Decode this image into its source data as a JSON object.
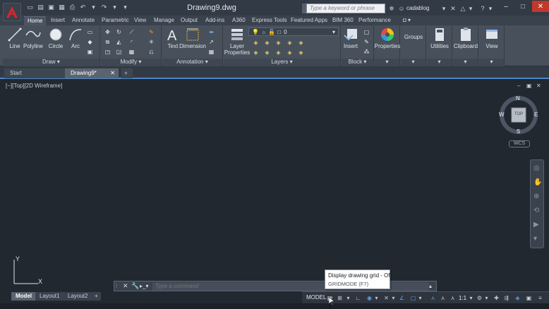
{
  "title_bar": {
    "document_title": "Drawing9.dwg",
    "search_placeholder": "Type a keyword or phrase",
    "user_name": "cadablog",
    "colors": {
      "background": "#323a45",
      "logo_red": "#d0282e",
      "close_button": "#c0392b"
    }
  },
  "quick_access": {
    "icons": [
      "new-icon",
      "open-icon",
      "save-icon",
      "save-as-icon",
      "print-icon",
      "undo-icon",
      "redo-icon",
      "dropdown-icon"
    ]
  },
  "ribbon_tabs": [
    "Home",
    "Insert",
    "Annotate",
    "Parametric",
    "View",
    "Manage",
    "Output",
    "Add-ins",
    "A360",
    "Express Tools",
    "Featured Apps",
    "BIM 360",
    "Performance"
  ],
  "ribbon": {
    "panels": {
      "draw": {
        "title": "Draw",
        "buttons": [
          "Line",
          "Polyline",
          "Circle",
          "Arc"
        ]
      },
      "modify": {
        "title": "Modify"
      },
      "annotation": {
        "title": "Annotation",
        "buttons": [
          "Text",
          "Dimension"
        ]
      },
      "layers": {
        "title": "Layers",
        "button": "Layer Properties",
        "current_layer": "0"
      },
      "block": {
        "title": "Block",
        "button": "Insert"
      },
      "properties": {
        "button": "Properties"
      },
      "groups": {
        "button": "Groups"
      },
      "utilities": {
        "button": "Utilities"
      },
      "clipboard": {
        "button": "Clipboard"
      },
      "view": {
        "button": "View"
      }
    }
  },
  "file_tabs": [
    {
      "label": "Start",
      "active": false
    },
    {
      "label": "Drawing9*",
      "active": true
    }
  ],
  "viewport": {
    "label": "[−][Top][2D Wireframe]",
    "viewcube": {
      "north": "N",
      "south": "S",
      "east": "E",
      "west": "W",
      "face": "TOP"
    },
    "wcs_label": "WCS",
    "ucs": {
      "x_label": "X",
      "y_label": "Y"
    },
    "background_color": "#212830"
  },
  "command_line": {
    "placeholder": "Type a command"
  },
  "tooltip": {
    "title": "Display drawing grid - Off",
    "shortcut": "GRIDMODE (F7)"
  },
  "layout_tabs": [
    {
      "label": "Model",
      "active": true
    },
    {
      "label": "Layout1",
      "active": false
    },
    {
      "label": "Layout2",
      "active": false
    }
  ],
  "status_bar": {
    "model_label": "MODEL",
    "annotation_scale": "1:1"
  }
}
